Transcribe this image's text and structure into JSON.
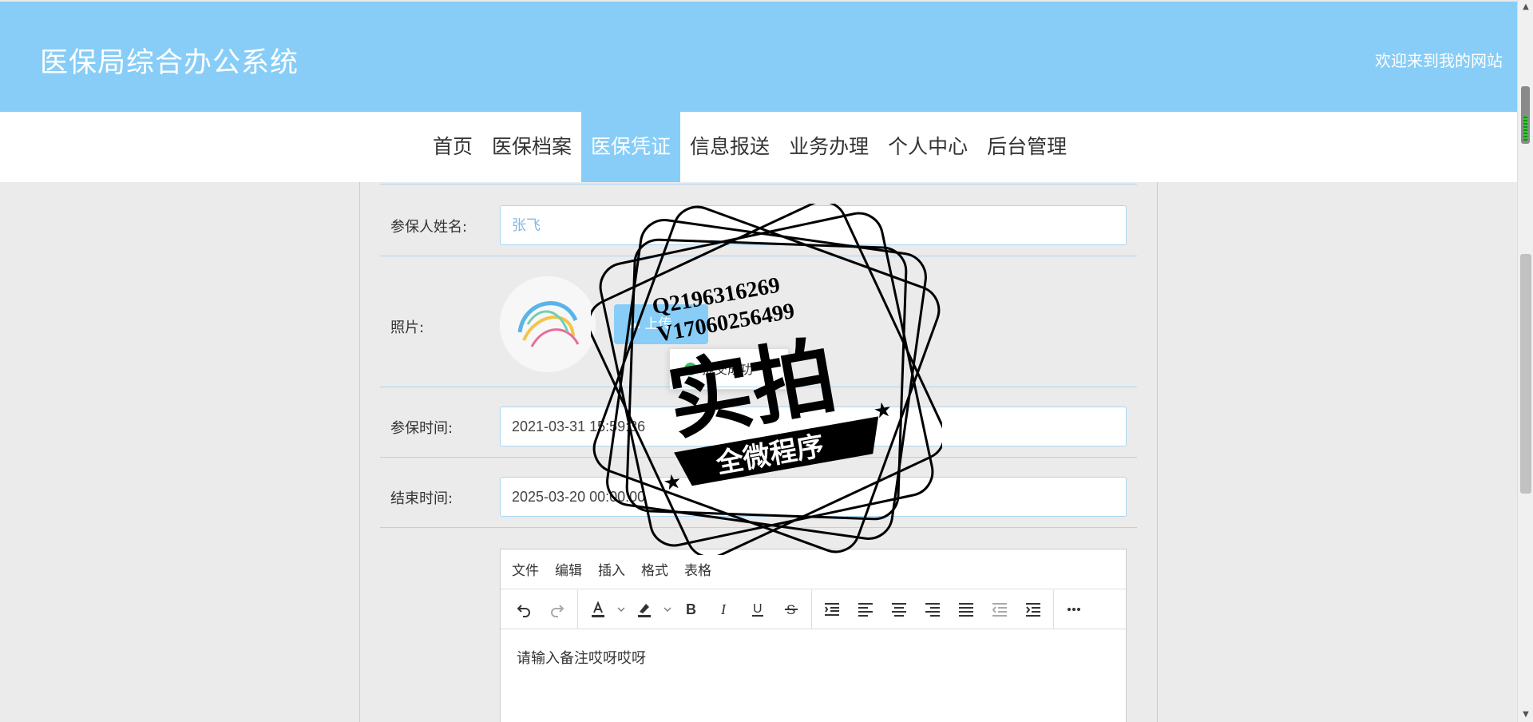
{
  "app": {
    "title": "医保局综合办公系统",
    "welcome": "欢迎来到我的网站"
  },
  "nav": {
    "items": [
      "首页",
      "医保档案",
      "医保凭证",
      "信息报送",
      "业务办理",
      "个人中心",
      "后台管理"
    ],
    "active": "医保凭证"
  },
  "form": {
    "name_label": "参保人姓名:",
    "name_value": "张飞",
    "photo_label": "照片:",
    "upload_label": "上传",
    "toast_text": "提交成功",
    "start_label": "参保时间:",
    "start_value": "2021-03-31 15:59:36",
    "end_label": "结束时间:",
    "end_value": "2025-03-20 00:00:00"
  },
  "editor": {
    "menu": [
      "文件",
      "编辑",
      "插入",
      "格式",
      "表格"
    ],
    "placeholder": "请输入备注哎呀哎呀"
  },
  "watermark": {
    "line1": "Q2196316269",
    "line2": "V17060256499",
    "big": "实拍",
    "band": "全微程序"
  },
  "colors": {
    "header": "#87cdf7",
    "active_tab": "#87cdf7",
    "border": "#a9d6f4"
  }
}
